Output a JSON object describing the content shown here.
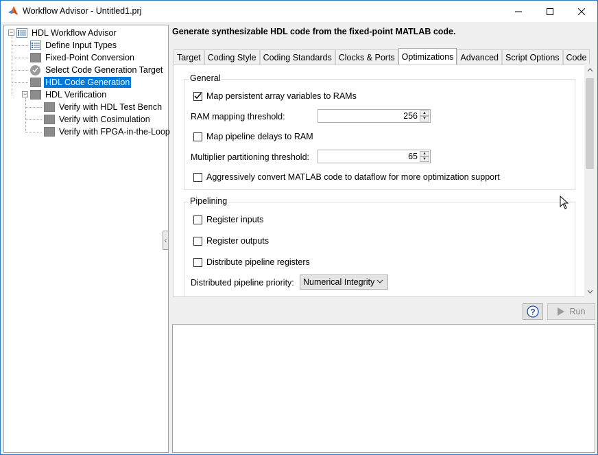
{
  "window": {
    "title": "Workflow Advisor - Untitled1.prj",
    "controls": [
      "minimize",
      "maximize",
      "close"
    ]
  },
  "tree": {
    "root": "HDL Workflow Advisor",
    "items": [
      {
        "label": "Define Input Types",
        "icon": "list-icon"
      },
      {
        "label": "Fixed-Point Conversion",
        "icon": "gray-box-icon"
      },
      {
        "label": "Select Code Generation Target",
        "icon": "check-circle-icon"
      },
      {
        "label": "HDL Code Generation",
        "icon": "gray-box-icon",
        "selected": true
      },
      {
        "label": "HDL Verification",
        "icon": "gray-box-icon"
      }
    ],
    "verification_children": [
      "Verify with HDL Test Bench",
      "Verify with Cosimulation",
      "Verify with FPGA-in-the-Loop"
    ]
  },
  "main": {
    "heading": "Generate synthesizable HDL code from the fixed-point MATLAB code.",
    "tabs": [
      "Target",
      "Coding Style",
      "Coding Standards",
      "Clocks & Ports",
      "Optimizations",
      "Advanced",
      "Script Options",
      "Code"
    ],
    "active_tab": "Optimizations"
  },
  "general": {
    "title": "General",
    "map_persistent_label": "Map persistent array variables to RAMs",
    "map_persistent_checked": true,
    "ram_threshold_label": "RAM mapping threshold:",
    "ram_threshold_value": "256",
    "map_pipeline_label": "Map pipeline delays to RAM",
    "map_pipeline_checked": false,
    "mult_partition_label": "Multiplier partitioning threshold:",
    "mult_partition_value": "65",
    "aggressive_label": "Aggressively convert MATLAB code to dataflow for more optimization support",
    "aggressive_checked": false
  },
  "pipelining": {
    "title": "Pipelining",
    "register_inputs_label": "Register inputs",
    "register_outputs_label": "Register outputs",
    "distribute_label": "Distribute pipeline registers",
    "priority_label": "Distributed pipeline priority:",
    "priority_value": "Numerical Integrity"
  },
  "buttons": {
    "help": "?",
    "run": "Run"
  },
  "colors": {
    "selection": "#0078d7",
    "window_border": "#2b78c5"
  }
}
